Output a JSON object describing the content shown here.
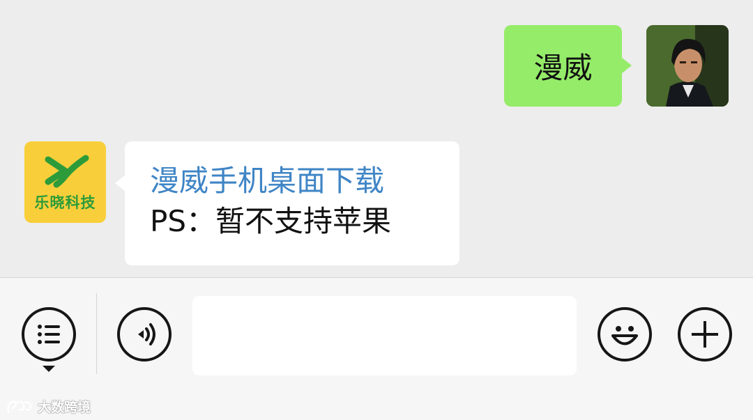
{
  "messages": {
    "outgoing": {
      "text": "漫威",
      "avatar": "user-photo-avatar"
    },
    "incoming": {
      "avatar_text": "乐晓科技",
      "link_text": "漫威手机桌面下载",
      "body_text": "PS：暂不支持苹果"
    }
  },
  "toolbar": {
    "menu_icon": "list-icon",
    "voice_icon": "voice-icon",
    "input_value": "",
    "emoji_icon": "smile-icon",
    "plus_icon": "plus-icon"
  },
  "watermark": {
    "text": "大数跨境"
  },
  "colors": {
    "background": "#ededed",
    "outgoing_bubble": "#95ec69",
    "incoming_bubble": "#ffffff",
    "link": "#3f85c6",
    "bot_avatar": "#f8cf3a",
    "bot_logo": "#2d9b3a"
  }
}
